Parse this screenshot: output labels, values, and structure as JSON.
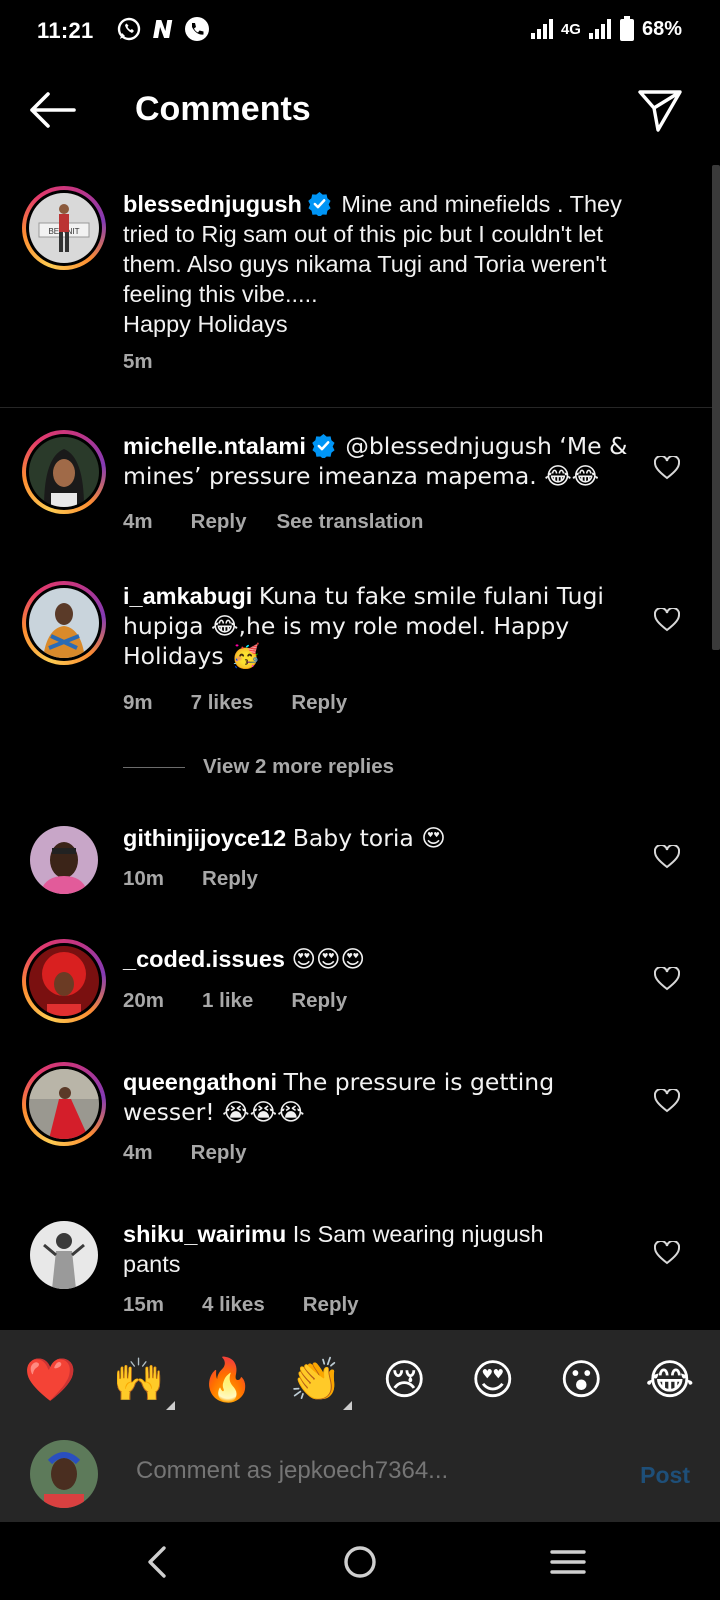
{
  "status": {
    "time": "11:21",
    "network": "4G",
    "battery": "68%"
  },
  "header": {
    "title": "Comments"
  },
  "caption": {
    "username": "blessednjugush",
    "text_lines": [
      "Mine and minefields . They",
      "tried to Rig sam out of this pic but I couldn't let",
      "them. Also guys nikama Tugi and Toria weren't",
      "feeling this vibe.....",
      "Happy Holidays"
    ],
    "time": "5m",
    "avatar_text": "BE KNIT"
  },
  "comments": [
    {
      "username": "michelle.ntalami",
      "verified": true,
      "line1": "@blessednjugush ‘Me &",
      "line2": "mines’ pressure imeanza mapema. 😂😂",
      "time": "4m",
      "reply": "Reply",
      "see_translation": "See translation"
    },
    {
      "username": "i_amkabugi",
      "line1": "Kuna tu fake smile fulani Tugi",
      "line2": "hupiga 😂,he is my role model. Happy",
      "line3": "Holidays 🥳",
      "time": "9m",
      "likes": "7 likes",
      "reply": "Reply"
    },
    {
      "username": "githinjijoyce12",
      "text": "Baby toria 😍",
      "time": "10m",
      "reply": "Reply"
    },
    {
      "username": "_coded.issues",
      "text": "😍😍😍",
      "time": "20m",
      "likes": "1 like",
      "reply": "Reply"
    },
    {
      "username": "queengathoni",
      "line1": "The pressure is getting",
      "line2": "wesser! 😭😭😭",
      "time": "4m",
      "reply": "Reply"
    },
    {
      "username": "shiku_wairimu",
      "line1": "Is Sam wearing njugush",
      "line2": "pants",
      "time": "15m",
      "likes": "4 likes",
      "reply": "Reply"
    }
  ],
  "view_more": "View 2 more replies",
  "reactions": [
    "❤️",
    "🙌",
    "🔥",
    "👏",
    "😢",
    "😍",
    "😮",
    "😂"
  ],
  "input": {
    "placeholder": "Comment as jepkoech7364...",
    "post_label": "Post"
  },
  "colors": {
    "background": "#000000",
    "muted_text": "#a8a8a8",
    "verified_blue": "#0095f6",
    "post_disabled": "#1e4f79"
  }
}
